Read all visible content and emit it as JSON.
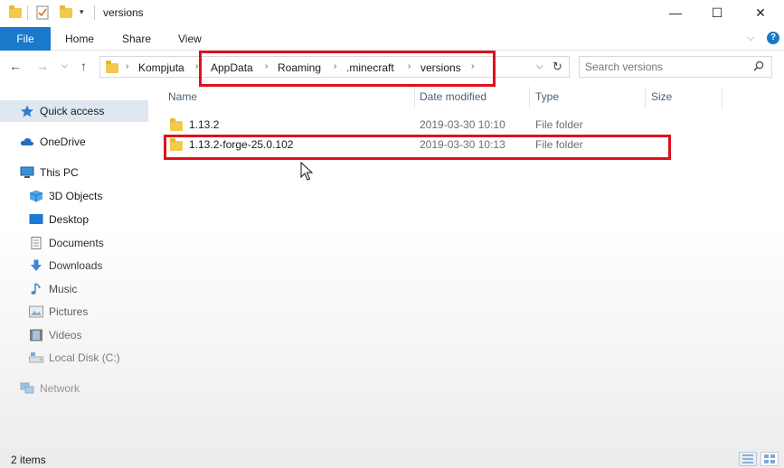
{
  "window": {
    "title": "versions",
    "minimize": "—",
    "maximize": "☐",
    "close": "✕"
  },
  "ribbon": {
    "tabs": [
      "File",
      "Home",
      "Share",
      "View"
    ]
  },
  "address": {
    "breadcrumb": [
      "Kompjuta",
      "AppData",
      "Roaming",
      ".minecraft",
      "versions"
    ],
    "search_placeholder": "Search versions"
  },
  "nav_pane": {
    "quick_access": "Quick access",
    "onedrive": "OneDrive",
    "this_pc": "This PC",
    "items": [
      "3D Objects",
      "Desktop",
      "Documents",
      "Downloads",
      "Music",
      "Pictures",
      "Videos",
      "Local Disk (C:)"
    ],
    "network": "Network"
  },
  "columns": {
    "name": "Name",
    "date_modified": "Date modified",
    "type": "Type",
    "size": "Size"
  },
  "files": [
    {
      "name": "1.13.2",
      "date": "2019-03-30 10:10",
      "type": "File folder"
    },
    {
      "name": "1.13.2-forge-25.0.102",
      "date": "2019-03-30 10:13",
      "type": "File folder"
    }
  ],
  "status": {
    "item_count": "2 items"
  },
  "colors": {
    "accent": "#1979ca",
    "annotation_red": "#e0101c",
    "folder_yellow": "#f2c94c"
  }
}
